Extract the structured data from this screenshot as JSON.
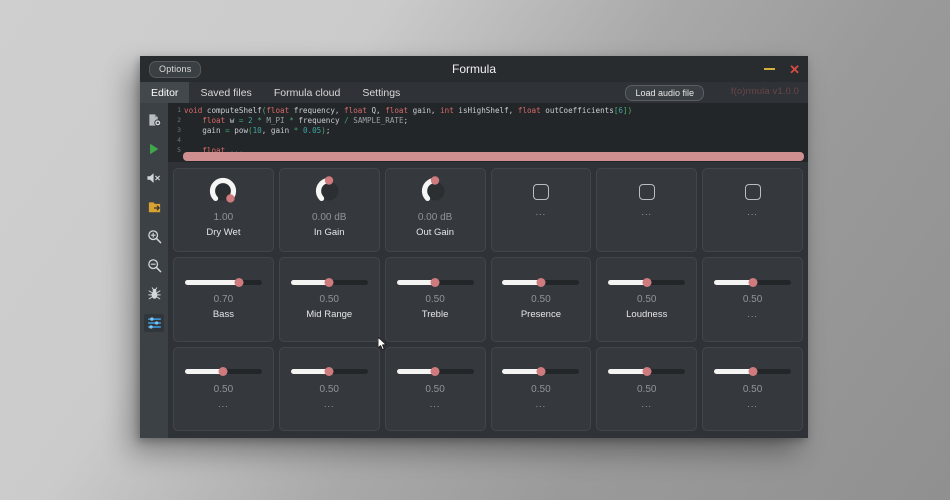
{
  "window": {
    "title": "Formula",
    "options_label": "Options",
    "minimize_icon": "minimize-icon",
    "close_icon": "close-icon"
  },
  "tabbar": {
    "tabs": [
      {
        "label": "Editor",
        "active": true
      },
      {
        "label": "Saved files",
        "active": false
      },
      {
        "label": "Formula cloud",
        "active": false
      },
      {
        "label": "Settings",
        "active": false
      }
    ],
    "load_audio_label": "Load audio file",
    "version_label": "f(o)rmula v1.0.0"
  },
  "sidebar": {
    "items": [
      {
        "name": "file-settings-icon",
        "selected": false
      },
      {
        "name": "play-icon",
        "selected": false
      },
      {
        "name": "mute-icon",
        "selected": false
      },
      {
        "name": "export-icon",
        "selected": false
      },
      {
        "name": "zoom-in-icon",
        "selected": false
      },
      {
        "name": "zoom-out-icon",
        "selected": false
      },
      {
        "name": "debug-bug-icon",
        "selected": false
      },
      {
        "name": "sliders-icon",
        "selected": true
      }
    ]
  },
  "editor": {
    "lines": [
      {
        "number": "1",
        "text": "void computeShelf(float frequency, float Q, float gain, int isHighShelf, float outCoefficients[6])"
      },
      {
        "number": "2",
        "text": "    float w = 2 * M_PI * frequency / SAMPLE_RATE;"
      },
      {
        "number": "3",
        "text": "    gain = pow(10, gain * 0.05);"
      },
      {
        "number": "4",
        "text": ""
      },
      {
        "number": "5",
        "text": "    float ..."
      }
    ],
    "scrollbar_color": "#cf8f90"
  },
  "controls": {
    "accent_color": "#cf7b7e",
    "cells": [
      {
        "type": "knob",
        "value": "1.00",
        "label": "Dry Wet",
        "knob_fraction": 1.0
      },
      {
        "type": "knob",
        "value": "0.00 dB",
        "label": "In Gain",
        "knob_fraction": 0.5
      },
      {
        "type": "knob",
        "value": "0.00 dB",
        "label": "Out Gain",
        "knob_fraction": 0.5
      },
      {
        "type": "empty",
        "value": "",
        "label": "..."
      },
      {
        "type": "empty",
        "value": "",
        "label": "..."
      },
      {
        "type": "empty",
        "value": "",
        "label": "..."
      },
      {
        "type": "slider",
        "value": "0.70",
        "label": "Bass",
        "fraction": 0.7
      },
      {
        "type": "slider",
        "value": "0.50",
        "label": "Mid Range",
        "fraction": 0.5
      },
      {
        "type": "slider",
        "value": "0.50",
        "label": "Treble",
        "fraction": 0.5
      },
      {
        "type": "slider",
        "value": "0.50",
        "label": "Presence",
        "fraction": 0.5
      },
      {
        "type": "slider",
        "value": "0.50",
        "label": "Loudness",
        "fraction": 0.5
      },
      {
        "type": "slider",
        "value": "0.50",
        "label": "...",
        "fraction": 0.5
      },
      {
        "type": "slider",
        "value": "0.50",
        "label": "...",
        "fraction": 0.5
      },
      {
        "type": "slider",
        "value": "0.50",
        "label": "...",
        "fraction": 0.5
      },
      {
        "type": "slider",
        "value": "0.50",
        "label": "...",
        "fraction": 0.5
      },
      {
        "type": "slider",
        "value": "0.50",
        "label": "...",
        "fraction": 0.5
      },
      {
        "type": "slider",
        "value": "0.50",
        "label": "...",
        "fraction": 0.5
      },
      {
        "type": "slider",
        "value": "0.50",
        "label": "...",
        "fraction": 0.5
      }
    ]
  }
}
